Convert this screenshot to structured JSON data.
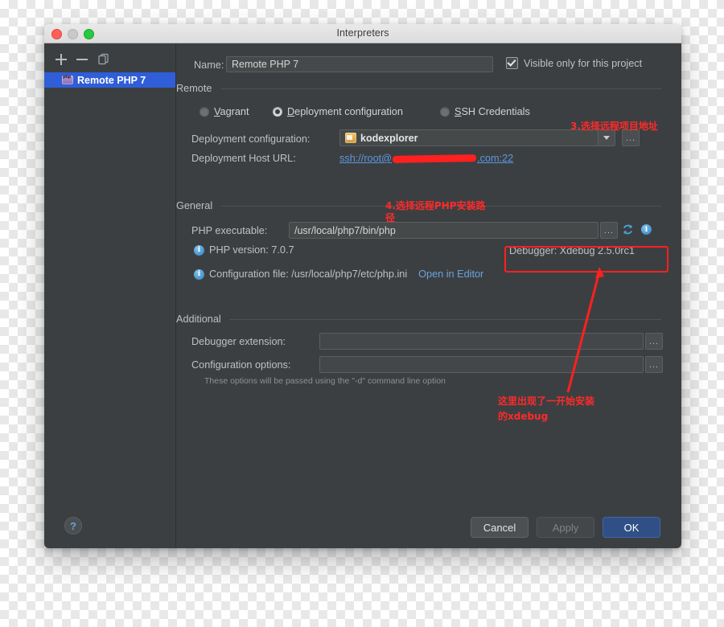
{
  "window": {
    "title": "Interpreters",
    "traffic_lights": [
      "close",
      "minimize",
      "zoom"
    ]
  },
  "sidebar": {
    "toolbar": [
      {
        "name": "add",
        "glyph": "+"
      },
      {
        "name": "remove",
        "glyph": "−"
      },
      {
        "name": "copy",
        "glyph": "copy"
      }
    ],
    "items": [
      {
        "label": "Remote PHP 7",
        "icon": "php-icon",
        "selected": true
      }
    ]
  },
  "form": {
    "name_label": "Name:",
    "name_value": "Remote PHP 7",
    "visible_only_label": "Visible only for this project",
    "visible_only_checked": true,
    "remote_section": "Remote",
    "radios": [
      {
        "label": "Vagrant",
        "mnemonic": "V",
        "selected": false
      },
      {
        "label": "Deployment configuration",
        "mnemonic": "D",
        "selected": true
      },
      {
        "label": "SSH Credentials",
        "mnemonic": "S",
        "selected": false
      }
    ],
    "deployment_config_label": "Deployment configuration:",
    "deployment_config_value": "kodexplorer",
    "deployment_host_label": "Deployment Host URL:",
    "deployment_host_prefix": "ssh://root@",
    "deployment_host_suffix": ".com:22",
    "general_section": "General",
    "php_executable_label": "PHP executable:",
    "php_executable_value": "/usr/local/php7/bin/php",
    "php_version_label": "PHP version: 7.0.7",
    "debugger_label": "Debugger: Xdebug 2.5.0rc1",
    "config_file_label": "Configuration file: /usr/local/php7/etc/php.ini",
    "open_in_editor_link": "Open in Editor",
    "additional_section": "Additional",
    "debugger_extension_label": "Debugger extension:",
    "debugger_extension_value": "",
    "configuration_options_label": "Configuration options:",
    "configuration_options_value": "",
    "options_hint": "These options will be passed using the \"-d\" command line option",
    "ellipsis_label": "..."
  },
  "footer": {
    "help_label": "?",
    "cancel_label": "Cancel",
    "apply_label": "Apply",
    "ok_label": "OK"
  },
  "annotations": [
    {
      "id": "a3",
      "text": "3.选择远程项目地址"
    },
    {
      "id": "a4_line1",
      "text": "4.选择远程PHP安装路"
    },
    {
      "id": "a4_line2",
      "text": "径"
    },
    {
      "id": "a5_line1",
      "text": "这里出现了一开始安装"
    },
    {
      "id": "a5_line2",
      "text": "的xdebug"
    }
  ],
  "colors": {
    "accent_blue": "#2f5ed8",
    "annotation_red": "#ff2a2a",
    "link_blue": "#6aa3e0",
    "panel_bg": "#3c3f41"
  }
}
